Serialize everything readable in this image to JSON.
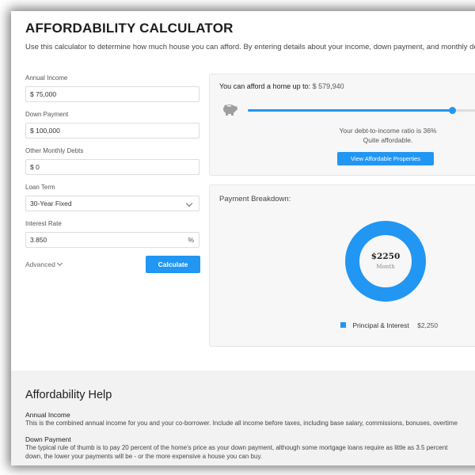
{
  "header": {
    "title": "AFFORDABILITY CALCULATOR",
    "intro": "Use this calculator to determine how much house you can afford. By entering details about your income, down payment, and monthly debts"
  },
  "form": {
    "annual_income": {
      "label": "Annual Income",
      "value": "$ 75,000"
    },
    "down_payment": {
      "label": "Down Payment",
      "value": "$ 100,000"
    },
    "other_debts": {
      "label": "Other Monthly Debts",
      "value": "$ 0"
    },
    "loan_term": {
      "label": "Loan Term",
      "value": "30-Year Fixed"
    },
    "interest_rate": {
      "label": "Interest Rate",
      "value": "3.850",
      "suffix": "%"
    },
    "advanced_label": "Advanced",
    "calculate_label": "Calculate"
  },
  "result": {
    "afford_label": "You can afford a home up to:",
    "afford_amount": "$ 579,940",
    "slider_fraction": 0.89,
    "dti_line1": "Your debt-to-income ratio is 36%",
    "dti_line2": "Quite affordable.",
    "view_button": "View Affordable Properties"
  },
  "breakdown": {
    "title": "Payment Breakdown:",
    "center_amount": "$2250",
    "center_unit": "Month",
    "legend": [
      {
        "label": "Principal & Interest",
        "value": "$2,250",
        "color": "#2196f3"
      }
    ]
  },
  "help": {
    "title": "Affordability Help",
    "sections": [
      {
        "heading": "Annual Income",
        "lines": [
          "This is the combined annual income for you and your co-borrower. Include all income before taxes, including base salary, commissions, bonuses, overtime"
        ]
      },
      {
        "heading": "Down Payment",
        "lines": [
          "The typical rule of thumb is to pay 20 percent of the home's price as your down payment, although some mortgage loans require as little as 3.5 percent",
          "down, the lower your payments will be - or the more expensive a house you can buy."
        ]
      }
    ]
  },
  "colors": {
    "accent": "#2196f3",
    "card_bg": "#f7f7f7",
    "help_bg": "#f2f2f2"
  }
}
